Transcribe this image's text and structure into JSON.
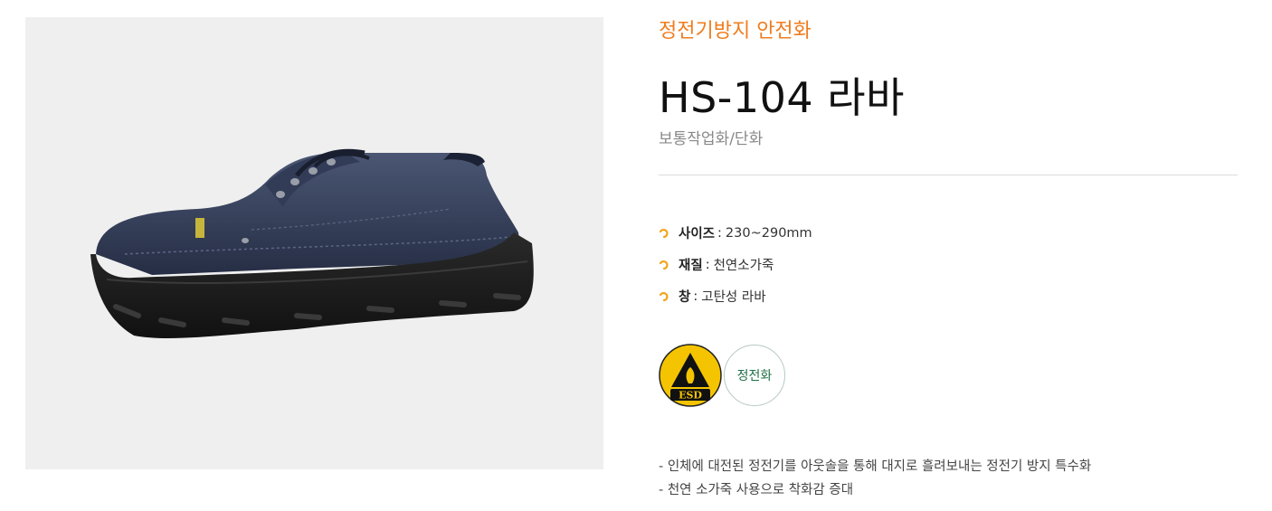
{
  "product": {
    "category": "정전기방지 안전화",
    "name": "HS-104 라바",
    "subtitle": "보통작업화/단화",
    "image_alt": "navy low-cut ESD safety shoe with black rubber outsole"
  },
  "specs": [
    {
      "label": "사이즈",
      "value": "230~290mm",
      "icon": "orange-arc-icon"
    },
    {
      "label": "재질",
      "value": "천연소가죽",
      "icon": "orange-arc-icon"
    },
    {
      "label": "창",
      "value": "고탄성 라바",
      "icon": "orange-arc-icon"
    }
  ],
  "spec_separator": ":",
  "badges": {
    "esd_text": "ESD",
    "cert_text": "정전화"
  },
  "description": [
    "- 인체에 대전된 정전기를 아웃솔을 통해 대지로 흘려보내는 정전기 방지 특수화",
    "- 천연 소가죽 사용으로 착화감 증대"
  ],
  "colors": {
    "accent": "#f07c1e",
    "icon": "#f2a51a",
    "cert": "#1f6f47",
    "esd_yellow": "#f5c400"
  }
}
